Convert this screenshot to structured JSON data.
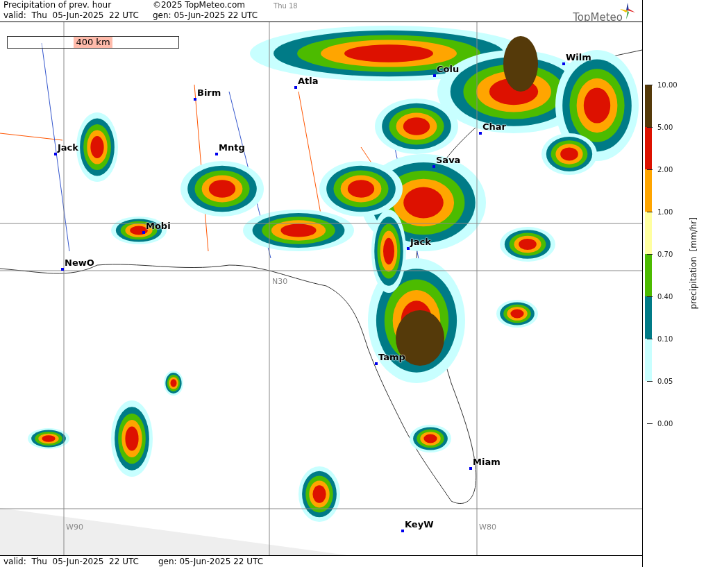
{
  "header": {
    "title": "Precipitation of prev. hour",
    "copyright": "©2025 TopMeteo.com",
    "run_label": "Thu 18",
    "valid": "valid:  Thu  05-Jun-2025  22 UTC",
    "generated": "gen: 05-Jun-2025 22 UTC",
    "logo": "TopMeteo"
  },
  "map": {
    "scale_label": "400 km",
    "grid_labels": [
      "W90",
      "W80",
      "N30"
    ],
    "cities": [
      "Colu",
      "Wilm",
      "Atla",
      "Birm",
      "Char",
      "Jack",
      "Mntg",
      "Sava",
      "Mobi",
      "Jack",
      "NewO",
      "Tamp",
      "Miam",
      "KeyW"
    ]
  },
  "legend": {
    "title": "precipitation  [mm/hr]",
    "ticks": [
      "10.00",
      "5.00",
      "2.00",
      "1.00",
      "0.70",
      "0.40",
      "0.10",
      "0.05",
      "0.00"
    ],
    "bands": [
      {
        "color": "#553a0a"
      },
      {
        "color": "#dd1100"
      },
      {
        "color": "#ffa500"
      },
      {
        "color": "#ffffa0"
      },
      {
        "color": "#4cbb00"
      },
      {
        "color": "#007b87"
      },
      {
        "color": "#c8ffff"
      }
    ]
  },
  "footer": {
    "valid": "valid:  Thu  05-Jun-2025  22 UTC",
    "generated": "gen: 05-Jun-2025 22 UTC"
  }
}
